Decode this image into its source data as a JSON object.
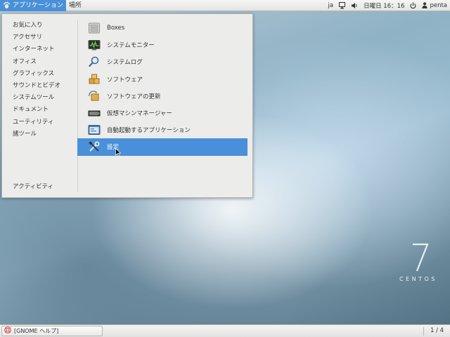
{
  "top_panel": {
    "applications_label": "アプリケーション",
    "places_label": "場所",
    "input_method": "ja",
    "clock": "日曜日 16：16",
    "user": "penta",
    "icons": [
      "applications-foot-icon",
      "network-icon",
      "volume-icon",
      "power-icon",
      "user-icon"
    ]
  },
  "menu": {
    "categories": [
      {
        "label": "お気に入り"
      },
      {
        "label": "アクセサリ"
      },
      {
        "label": "インターネット"
      },
      {
        "label": "オフィス"
      },
      {
        "label": "グラフィックス"
      },
      {
        "label": "サウンドとビデオ"
      },
      {
        "label": "システムツール"
      },
      {
        "label": "ドキュメント"
      },
      {
        "label": "ユーティリティ"
      },
      {
        "label": "諸ツール"
      }
    ],
    "activities_label": "アクティビティ",
    "items": [
      {
        "label": "Boxes",
        "icon": "boxes-icon"
      },
      {
        "label": "システムモニター",
        "icon": "system-monitor-icon"
      },
      {
        "label": "システムログ",
        "icon": "system-log-icon"
      },
      {
        "label": "ソフトウェア",
        "icon": "software-icon"
      },
      {
        "label": "ソフトウェアの更新",
        "icon": "software-update-icon"
      },
      {
        "label": "仮想マシンマネージャー",
        "icon": "virt-manager-icon"
      },
      {
        "label": "自動起動するアプリケーション",
        "icon": "startup-apps-icon"
      },
      {
        "label": "設定",
        "icon": "settings-tools-icon",
        "selected": true
      }
    ]
  },
  "watermark": {
    "version": "7",
    "text": "CENTOS"
  },
  "bottom_panel": {
    "task_label": "[GNOME ヘルプ]",
    "workspace": "1 / 4"
  },
  "colors": {
    "accent": "#4a90d9",
    "menu_bg": "#ececeb",
    "panel_bg": "#e9e9e7"
  }
}
